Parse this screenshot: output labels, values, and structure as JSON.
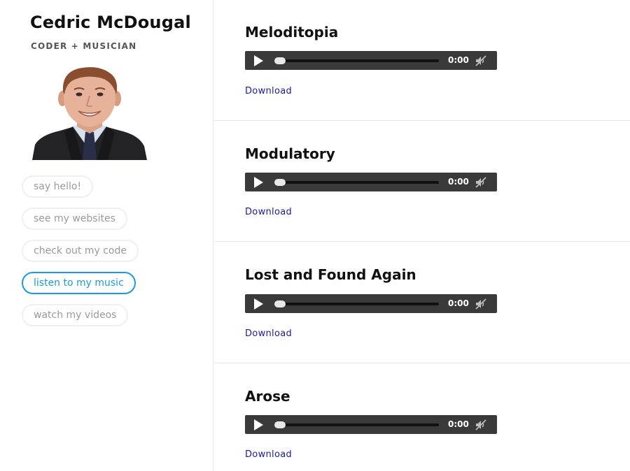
{
  "profile": {
    "name": "Cedric McDougal",
    "tagline": "CODER + MUSICIAN",
    "avatar_icon": "portrait-photo"
  },
  "nav": {
    "items": [
      {
        "label": "say hello!",
        "active": false
      },
      {
        "label": "see my websites",
        "active": false
      },
      {
        "label": "check out my code",
        "active": false
      },
      {
        "label": "listen to my music",
        "active": true
      },
      {
        "label": "watch my videos",
        "active": false
      }
    ]
  },
  "tracks": [
    {
      "title": "Meloditopia",
      "time": "0:00",
      "download_label": "Download",
      "progress": 0
    },
    {
      "title": "Modulatory",
      "time": "0:00",
      "download_label": "Download",
      "progress": 0
    },
    {
      "title": "Lost and Found Again",
      "time": "0:00",
      "download_label": "Download",
      "progress": 0
    },
    {
      "title": "Arose",
      "time": "0:00",
      "download_label": "Download",
      "progress": 0
    }
  ],
  "colors": {
    "accent": "#1a9ae0",
    "player_bg": "#3a3a3a",
    "link": "#1a1aa8"
  },
  "icons": {
    "play": "play-icon",
    "mute": "volume-mute-icon"
  }
}
